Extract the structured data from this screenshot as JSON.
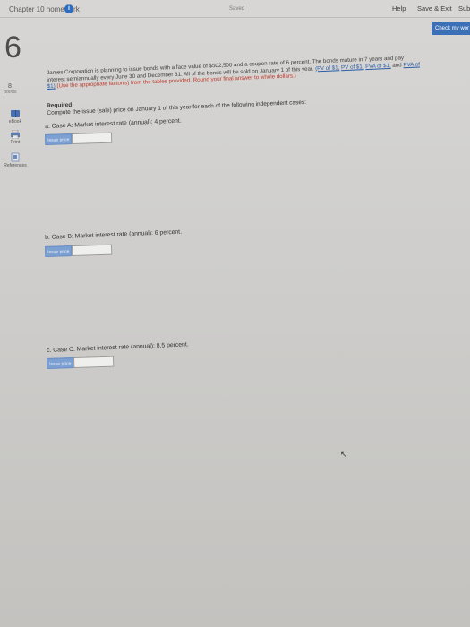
{
  "header": {
    "chapter_title": "Chapter 10 homework",
    "info_icon": "i",
    "saved_status": "Saved",
    "help_label": "Help",
    "save_exit_label": "Save & Exit",
    "submit_label": "Subm",
    "check_work_label": "Check my wor"
  },
  "question": {
    "number": "6",
    "points_value": "8",
    "points_label": "points"
  },
  "sidebar": {
    "tools": [
      {
        "label": "eBook",
        "icon": "book-icon"
      },
      {
        "label": "Print",
        "icon": "printer-icon"
      },
      {
        "label": "References",
        "icon": "references-icon"
      }
    ]
  },
  "problem": {
    "text_part1": "James Corporation is planning to issue bonds with a face value of $502,500 and a coupon rate of 6 percent. The bonds mature in 7 years and pay interest semiannually every June 30 and December 31. All of the bonds will be sold on January 1 of this year.",
    "link_fv": "(FV of $1,",
    "link_pv": "PV of $1,",
    "link_fva": "FVA of $1,",
    "and_text": "and",
    "link_pva": "PVA of $1)",
    "red_instructions": "(Use the appropriate factor(s) from the tables provided. Round your final answer to whole dollars.)"
  },
  "required": {
    "heading": "Required:",
    "instruction": "Compute the issue (sale) price on January 1 of this year for each of the following independent cases:"
  },
  "cases": [
    {
      "label": "a. Case A: Market interest rate (annual): 4 percent.",
      "field_label": "Issue price",
      "value": ""
    },
    {
      "label": "b. Case B: Market interest rate (annual): 6 percent.",
      "field_label": "Issue price",
      "value": ""
    },
    {
      "label": "c. Case C: Market interest rate (annual): 8.5 percent.",
      "field_label": "Issue price",
      "value": ""
    }
  ],
  "colors": {
    "accent_blue": "#3b6fb6",
    "field_label_bg": "#7da0d2",
    "instruction_red": "#c0392b",
    "link_blue": "#2a5ea8"
  }
}
